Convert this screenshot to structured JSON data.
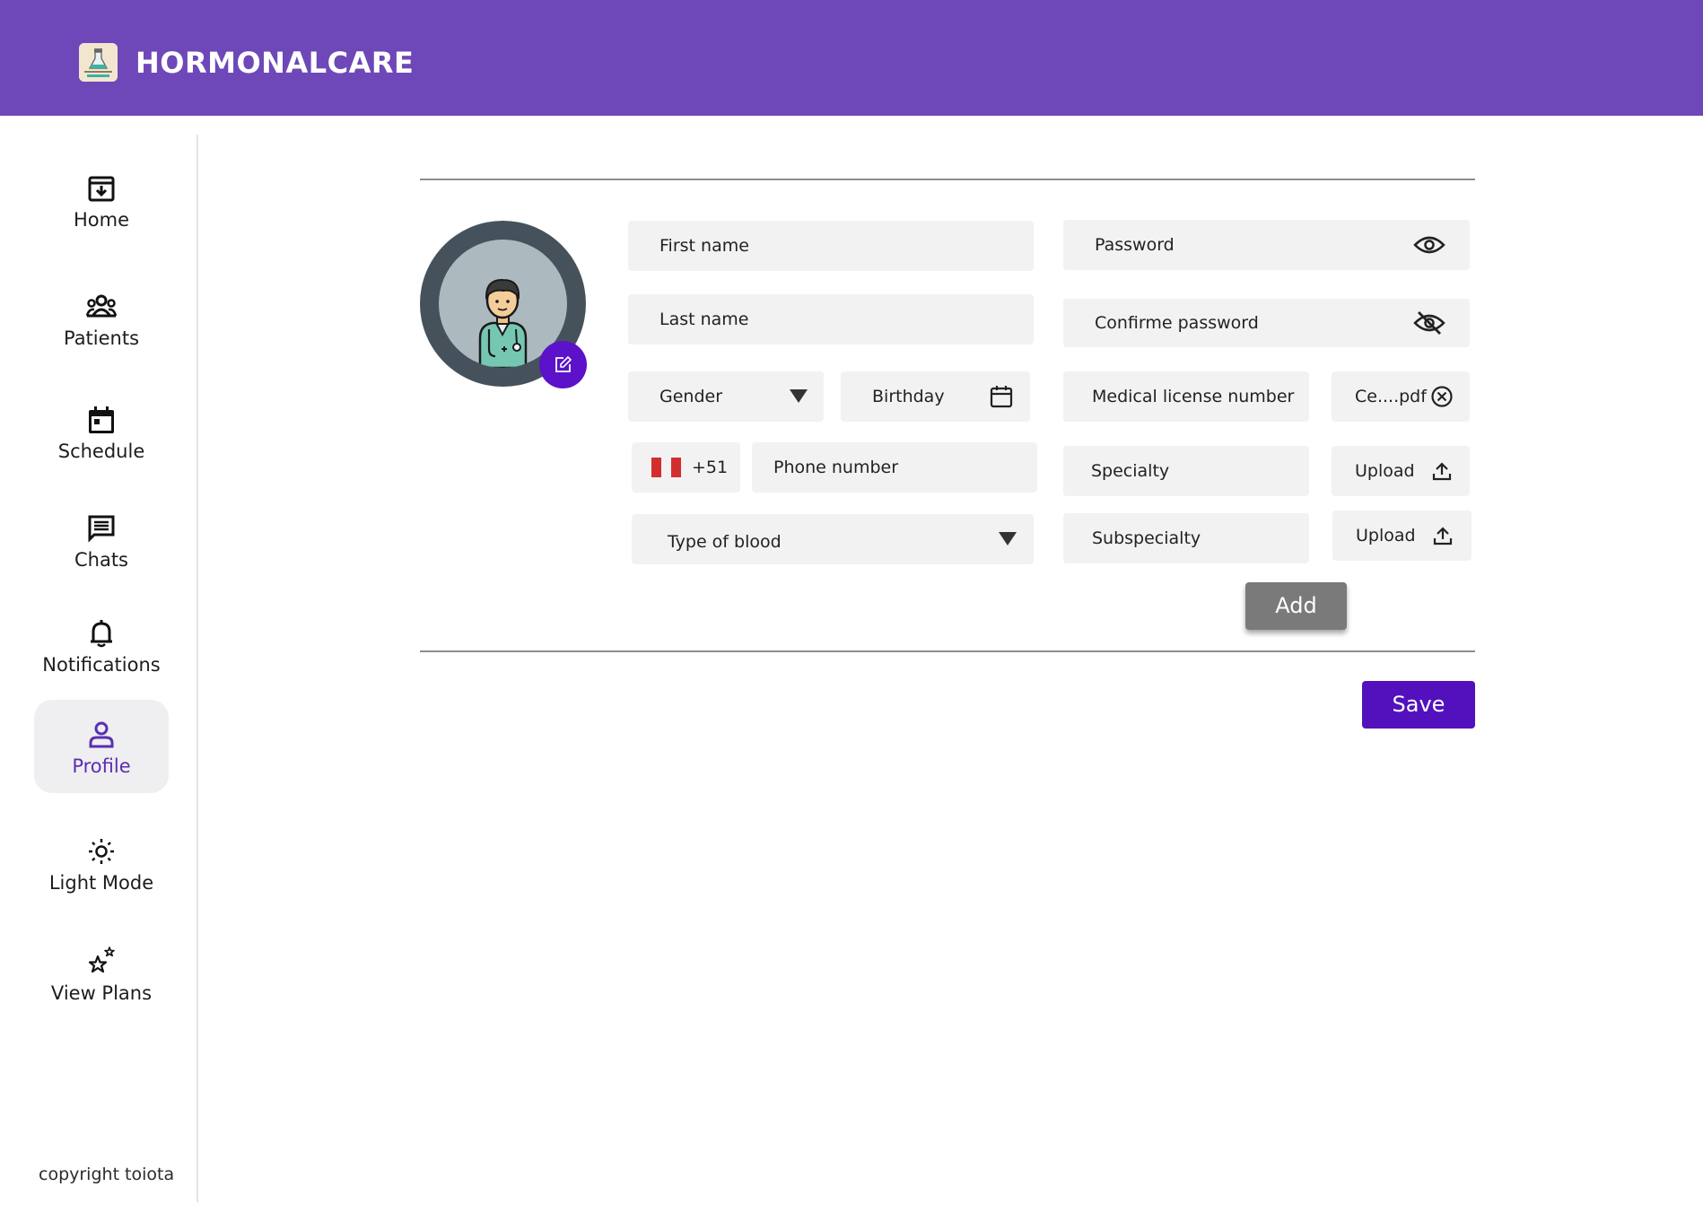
{
  "colors": {
    "brand": "#6e48b8",
    "accent": "#5311be",
    "active_nav_text": "#5b2fb0",
    "field_bg": "#f2f2f2"
  },
  "header": {
    "title": "HORMONALCARE",
    "logo_icon": "flask-logo-icon"
  },
  "sidebar": {
    "items": [
      {
        "label": "Home",
        "icon": "home-archive-icon"
      },
      {
        "label": "Patients",
        "icon": "group-icon"
      },
      {
        "label": "Schedule",
        "icon": "calendar-icon"
      },
      {
        "label": "Chats",
        "icon": "chat-icon"
      },
      {
        "label": "Notifications",
        "icon": "bell-icon"
      },
      {
        "label": "Profile",
        "icon": "person-icon",
        "active": true
      },
      {
        "label": "Light Mode",
        "icon": "sun-icon"
      },
      {
        "label": "View Plans",
        "icon": "stars-icon"
      }
    ],
    "copyright": "copyright toiota"
  },
  "profile": {
    "avatar_icon": "doctor-avatar-icon",
    "edit_icon": "edit-icon"
  },
  "form": {
    "first_name": "First name",
    "last_name": "Last name",
    "gender": "Gender",
    "birthday": "Birthday",
    "country_code": "+51",
    "country_flag": "peru-flag-icon",
    "phone": "Phone number",
    "blood_type": "Type of blood",
    "password": "Password",
    "confirm_password": "Confirme password",
    "medical_license": "Medical license number",
    "license_file": "Ce....pdf",
    "specialty": "Specialty",
    "subspecialty": "Subspecialty",
    "upload_1": "Upload",
    "upload_2": "Upload"
  },
  "actions": {
    "add": "Add",
    "save": "Save"
  }
}
